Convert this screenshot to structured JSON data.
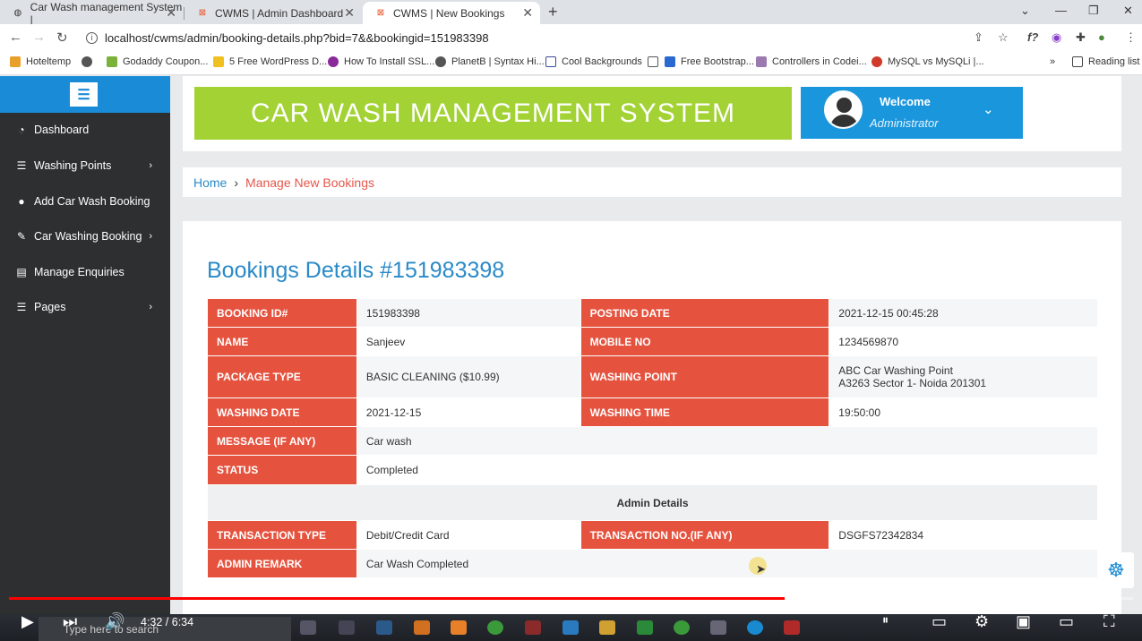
{
  "browser": {
    "tabs": [
      {
        "title": "Car Wash management System |",
        "active": false
      },
      {
        "title": "CWMS | Admin Dashboard",
        "active": false
      },
      {
        "title": "CWMS | New Bookings",
        "active": true
      }
    ],
    "url": "localhost/cwms/admin/booking-details.php?bid=7&&bookingid=151983398",
    "bookmarks": [
      "Hoteltemp",
      "Godaddy Coupon...",
      "5 Free WordPress D...",
      "How To Install SSL...",
      "PlanetB | Syntax Hi...",
      "Cool Backgrounds",
      "Free Bootstrap...",
      "Controllers in Codei...",
      "MySQL vs MySQLi |..."
    ],
    "bookmarks_more": "»",
    "reading_list": "Reading list"
  },
  "sidebar": {
    "items": [
      {
        "label": "Dashboard",
        "icon": "dashboard-icon",
        "chevron": false
      },
      {
        "label": "Washing Points",
        "icon": "list-icon",
        "chevron": true
      },
      {
        "label": "Add Car Wash Booking",
        "icon": "user-icon",
        "chevron": false
      },
      {
        "label": "Car Washing Booking",
        "icon": "edit-icon",
        "chevron": true
      },
      {
        "label": "Manage Enquiries",
        "icon": "file-icon",
        "chevron": false
      },
      {
        "label": "Pages",
        "icon": "list-icon",
        "chevron": true
      }
    ]
  },
  "header": {
    "title": "CAR WASH MANAGEMENT SYSTEM",
    "welcome": "Welcome",
    "role": "Administrator"
  },
  "breadcrumb": {
    "home": "Home",
    "current": "Manage New Bookings"
  },
  "details": {
    "title": "Bookings Details #151983398",
    "booking_id_label": "BOOKING ID#",
    "booking_id": "151983398",
    "posting_date_label": "POSTING DATE",
    "posting_date": "2021-12-15 00:45:28",
    "name_label": "NAME",
    "name": "Sanjeev",
    "mobile_label": "MOBILE NO",
    "mobile": "1234569870",
    "package_label": "PACKAGE TYPE",
    "package": "BASIC CLEANING ($10.99)",
    "washing_point_label": "WASHING POINT",
    "washing_point_line1": "ABC Car Washing Point",
    "washing_point_line2": "A3263 Sector 1- Noida 201301",
    "washing_date_label": "WASHING DATE",
    "washing_date": "2021-12-15",
    "washing_time_label": "WASHING TIME",
    "washing_time": "19:50:00",
    "message_label": "MESSAGE (IF ANY)",
    "message": "Car wash",
    "status_label": "STATUS",
    "status": "Completed",
    "admin_heading": "Admin Details",
    "transaction_type_label": "TRANSACTION TYPE",
    "transaction_type": "Debit/Credit Card",
    "transaction_no_label": "TRANSACTION NO.(IF ANY)",
    "transaction_no": "DSGFS72342834",
    "admin_remark_label": "ADMIN REMARK",
    "admin_remark": "Car Wash Completed"
  },
  "video": {
    "time": "4:32 / 6:34",
    "progress": 0.69,
    "search_placeholder": "Type here to search"
  },
  "colors": {
    "sidebar_bg": "#2d2f31",
    "accent_blue": "#1a8bd6",
    "banner_green": "#a2d233",
    "label_red": "#e5533f"
  }
}
